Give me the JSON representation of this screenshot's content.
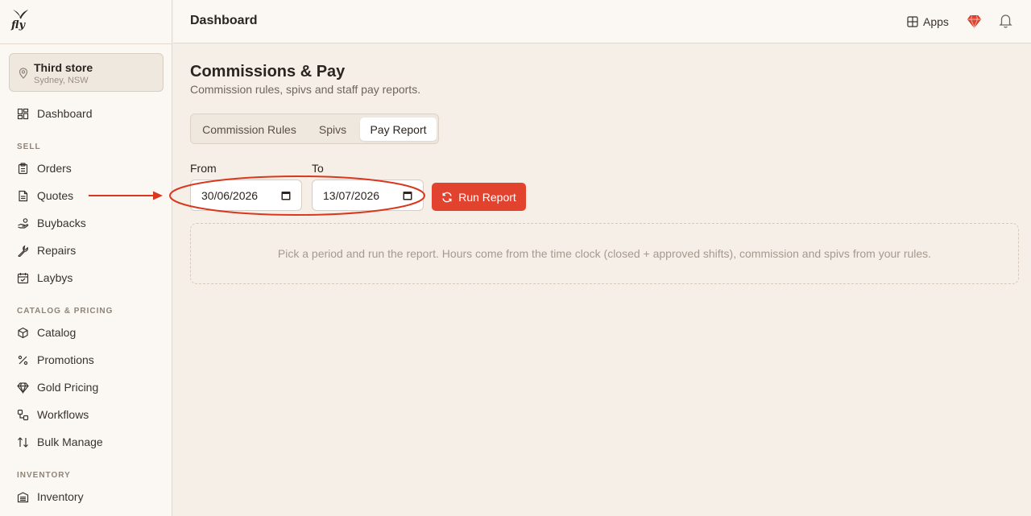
{
  "brand": {
    "logo_text": "fly"
  },
  "store": {
    "name": "Third store",
    "location": "Sydney, NSW"
  },
  "nav": {
    "dashboard": "Dashboard",
    "sections": {
      "sell": "SELL",
      "catalog_pricing": "CATALOG & PRICING",
      "inventory": "INVENTORY"
    },
    "sell_items": [
      "Orders",
      "Quotes",
      "Buybacks",
      "Repairs",
      "Laybys"
    ],
    "catalog_items": [
      "Catalog",
      "Promotions",
      "Gold Pricing",
      "Workflows",
      "Bulk Manage"
    ],
    "inventory_items": [
      "Inventory"
    ]
  },
  "topbar": {
    "title": "Dashboard",
    "apps_label": "Apps"
  },
  "page": {
    "title": "Commissions & Pay",
    "subtitle": "Commission rules, spivs and staff pay reports."
  },
  "tabs": [
    {
      "label": "Commission Rules",
      "active": false
    },
    {
      "label": "Spivs",
      "active": false
    },
    {
      "label": "Pay Report",
      "active": true
    }
  ],
  "report": {
    "from_label": "From",
    "from_value": "30/06/2026",
    "to_label": "To",
    "to_value": "13/07/2026",
    "run_label": "Run Report",
    "empty_message": "Pick a period and run the report. Hours come from the time clock (closed + approved shifts), commission and spivs from your rules."
  },
  "colors": {
    "accent": "#e2432f",
    "background": "#f6efe7",
    "sidebar": "#fbf8f4",
    "annotation": "#d9381e"
  }
}
